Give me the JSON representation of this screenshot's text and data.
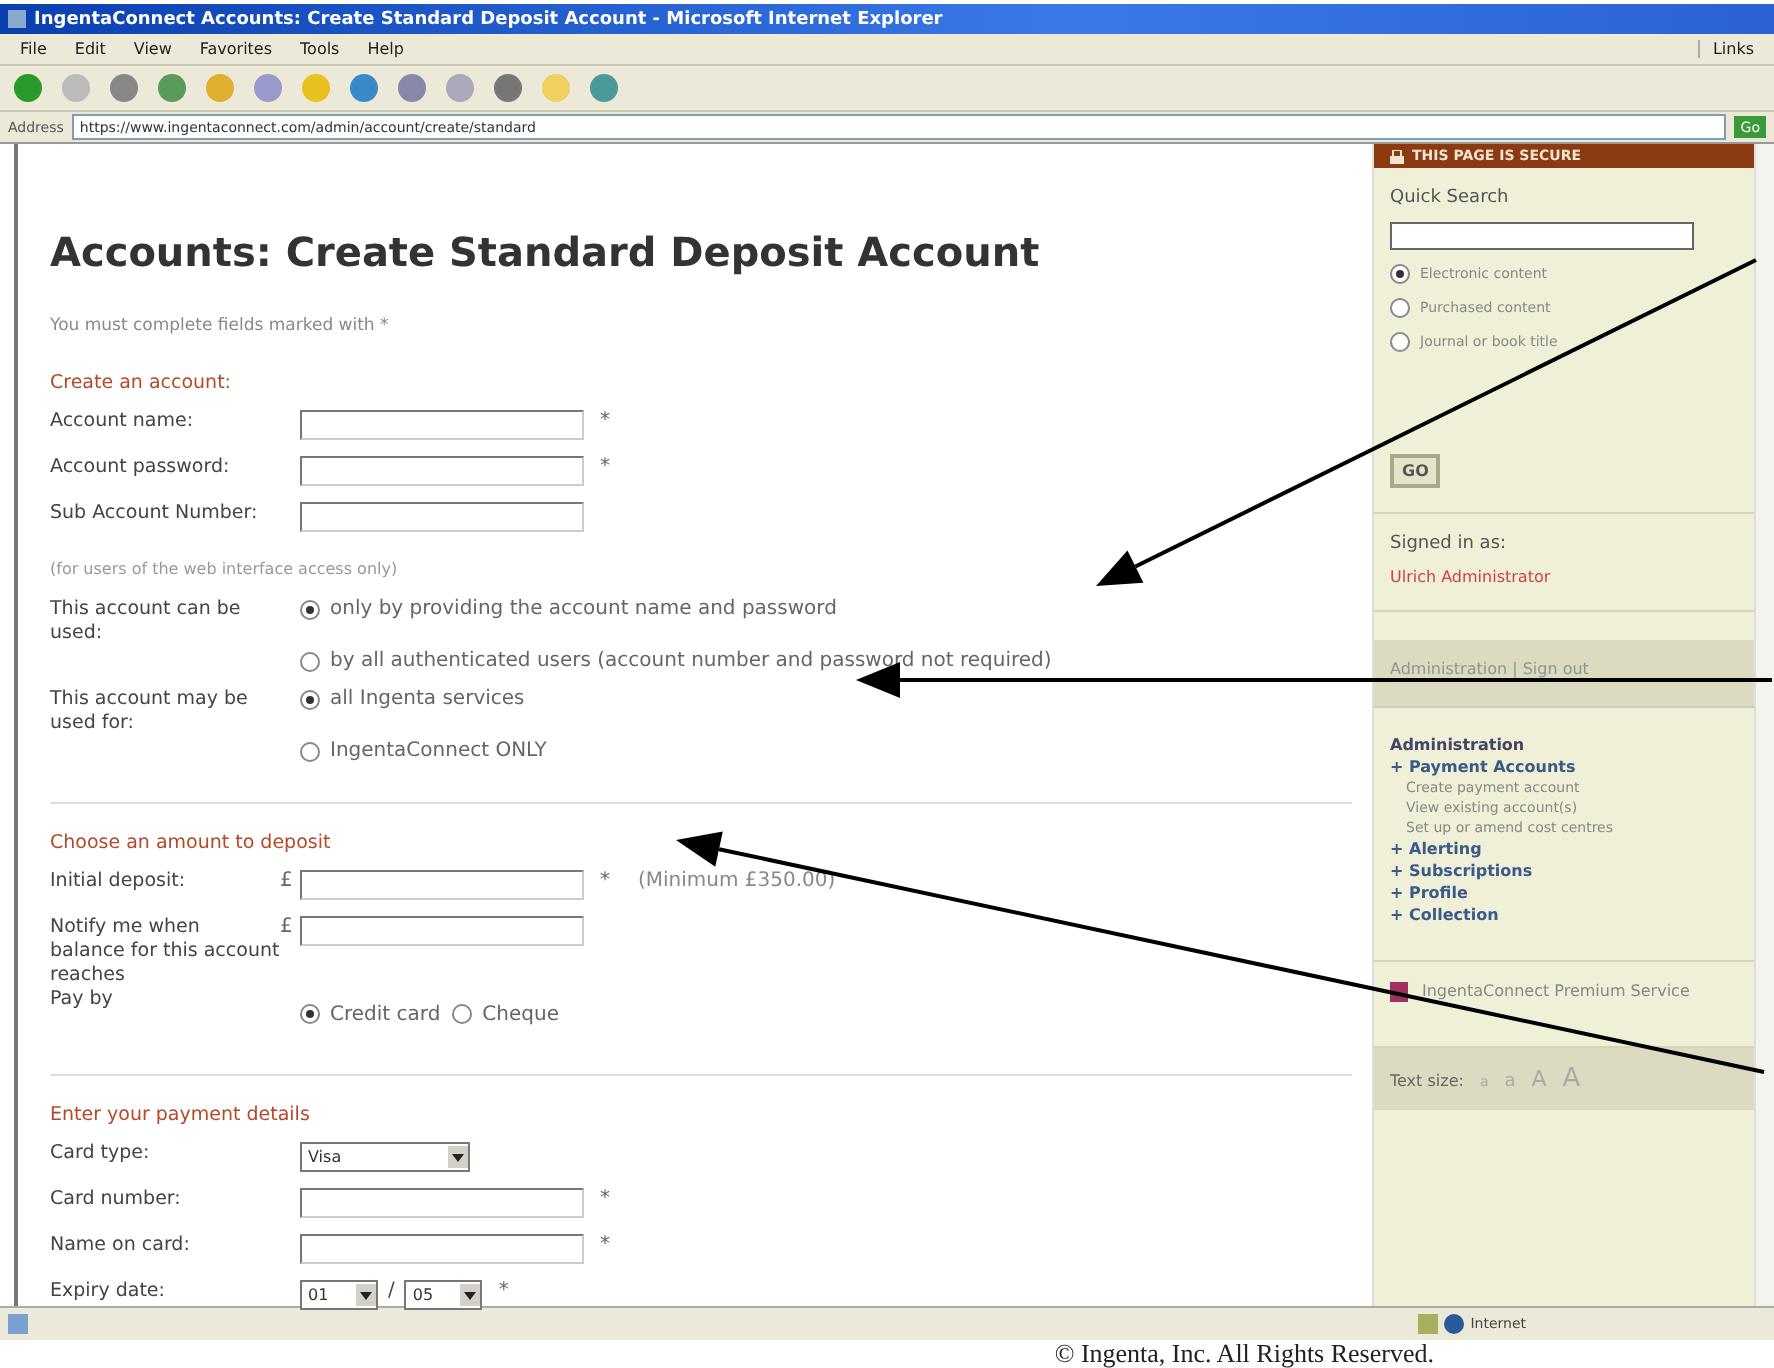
{
  "window": {
    "title": "IngentaConnect Accounts: Create Standard Deposit Account - Microsoft Internet Explorer"
  },
  "menu": [
    "File",
    "Edit",
    "View",
    "Favorites",
    "Tools",
    "Help"
  ],
  "links_label": "Links",
  "address": {
    "label": "Address",
    "url": "https://www.ingentaconnect.com/admin/account/create/standard",
    "go": "Go"
  },
  "page": {
    "title": "Accounts: Create Standard Deposit Account",
    "instruction": "You must complete fields marked with *",
    "sections": [
      {
        "heading": "Create an account:",
        "rows": [
          {
            "kind": "text",
            "label": "Account name:",
            "mark": "*"
          },
          {
            "kind": "text",
            "label": "Account password:",
            "mark": "*"
          },
          {
            "kind": "text",
            "label": "Sub Account Number:"
          },
          {
            "kind": "note",
            "text": "(for users of the web interface access only)"
          },
          {
            "kind": "radio",
            "label": "This account can be used:",
            "options": [
              {
                "label": "only by providing the account name and password",
                "selected": true
              },
              {
                "label": "by all authenticated users (account number and password not required)",
                "selected": false
              }
            ]
          },
          {
            "kind": "radio",
            "label": "This account may be used for:",
            "options": [
              {
                "label": "all Ingenta services",
                "selected": true
              },
              {
                "label": "IngentaConnect ONLY",
                "selected": false
              }
            ]
          }
        ]
      },
      {
        "heading": "Choose an amount to deposit",
        "rows": [
          {
            "kind": "text",
            "label": "Initial deposit:",
            "prefix": "£",
            "mark": "*",
            "note": "(Minimum £350.00)"
          },
          {
            "kind": "text",
            "label": "Notify me when balance for this account reaches",
            "prefix": "£"
          },
          {
            "kind": "radio-inline",
            "label": "Pay by",
            "options": [
              {
                "label": "Credit card",
                "selected": true
              },
              {
                "label": "Cheque",
                "selected": false
              }
            ]
          }
        ]
      },
      {
        "heading": "Enter your payment details",
        "rows": [
          {
            "kind": "select",
            "label": "Card type:",
            "value": "Visa"
          },
          {
            "kind": "text",
            "label": "Card number:",
            "mark": "*"
          },
          {
            "kind": "text",
            "label": "Name on card:",
            "mark": "*"
          },
          {
            "kind": "date",
            "label": "Expiry date:",
            "month": "01",
            "separator": "/",
            "year": "05",
            "mark": "*"
          }
        ]
      }
    ]
  },
  "sidebar": {
    "banner": "THIS PAGE IS SECURE",
    "search_title": "Quick Search",
    "search_options": [
      {
        "label": "Electronic content",
        "selected": true
      },
      {
        "label": "Purchased content",
        "selected": false
      },
      {
        "label": "Journal or book title",
        "selected": false
      }
    ],
    "go": "GO",
    "signed_in_label": "Signed in as:",
    "signed_in_user": "Ulrich Administrator",
    "account_bar": "Administration | Sign out",
    "admin_title": "Administration",
    "admin_items": [
      {
        "label": "Payment Accounts",
        "children": [
          {
            "label": "Create payment account"
          },
          {
            "label": "View existing account(s)"
          },
          {
            "label": "Set up or amend cost centres"
          }
        ]
      },
      {
        "label": "Alerting"
      },
      {
        "label": "Subscriptions"
      },
      {
        "label": "Profile"
      },
      {
        "label": "Collection"
      }
    ],
    "bullet": "+",
    "premium": "IngentaConnect Premium Service",
    "text_size_label": "Text size:",
    "text_sizes": [
      "a",
      "a",
      "A",
      "A"
    ]
  },
  "status_bar": {
    "zone": "Internet"
  },
  "footer": "© Ingenta, Inc. All Rights Reserved."
}
